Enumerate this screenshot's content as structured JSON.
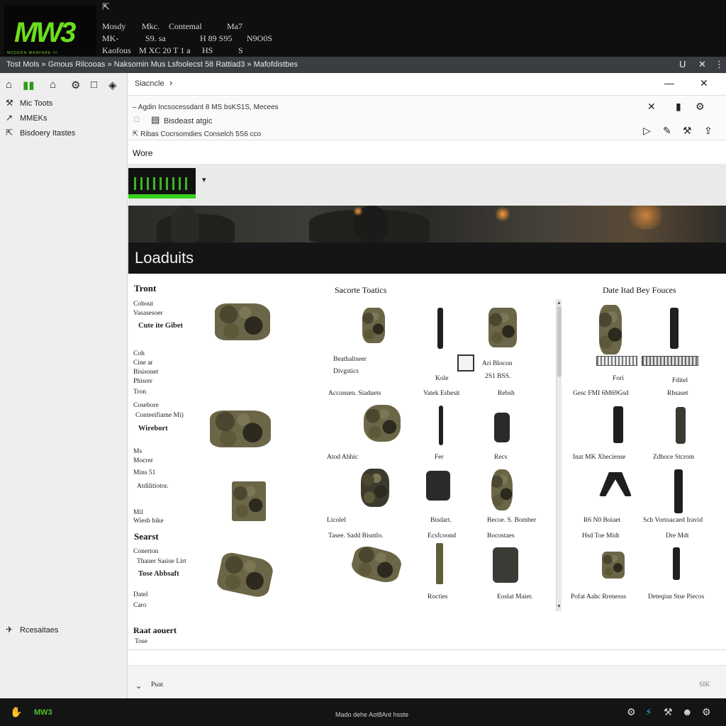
{
  "header": {
    "logo_text": "MW3",
    "logo_sub": "MODERN WARFARE III",
    "row1": [
      "Mosdy",
      "Mkc.",
      "Contemal",
      "Ma7"
    ],
    "row2": [
      "MK-",
      "S9. sa",
      "H 89 S95",
      "N9O0S"
    ],
    "row3": [
      "Kaofous",
      "M XC 20 T 1 a",
      "HS",
      "S"
    ]
  },
  "breadcrumb": {
    "items": [
      "Tost Mols",
      "Gmous Rilcooas",
      "Naksomin Mus",
      "Lsfoolecst 58 Rattiad3",
      "Mafofdistbes"
    ],
    "window_controls": [
      "U",
      "✕",
      "⋮"
    ]
  },
  "sidebar": {
    "items": [
      {
        "label": "Mic Toots",
        "icon": "⚒"
      },
      {
        "label": "MMEKs",
        "icon": "\\u2197"
      },
      {
        "label": "Bisdoery Itastes",
        "icon": "\\u21f1"
      }
    ],
    "bottom_item": {
      "label": "Rcesaitaes",
      "icon": "\\u2708"
    }
  },
  "toolbar": {
    "path_label": "Siacncle",
    "row1": "Agdin Incsocessdant 8 MS bsKS1S, Mecees",
    "row2": "Bisdeast atgic",
    "row3": "Ribas Cocrsomdies Conselch 5S6 cco"
  },
  "section": {
    "wore_label": "Wore",
    "banner_title": "Loaduits"
  },
  "left_column": {
    "heading": "Tront",
    "groups": [
      {
        "lines": [
          "Cobout",
          "Vasasesoer"
        ],
        "bold": "Cute ite Gibet"
      },
      {
        "lines": [
          "Coh",
          "Cine ar",
          "Bisisonet",
          "Phisrer",
          "Tron"
        ],
        "bold": ""
      },
      {
        "lines": [
          "Cosebore",
          "Conteeifiame Mi)"
        ],
        "bold": "Wirebort"
      },
      {
        "lines": [
          "Ms",
          "Mocrer",
          "Mins 51"
        ],
        "bold": "Atdilitiotor."
      },
      {
        "lines": [
          "Mil",
          "Wiesb bike"
        ],
        "bold": ""
      }
    ],
    "heading2": "Searst",
    "group2": {
      "lines": [
        "Conerton",
        "Thaner Sasise Lirt"
      ],
      "bold": "Tose Abbsaft"
    },
    "tail": [
      "Datel",
      "Caro"
    ]
  },
  "middle_column": {
    "heading": "Sacorte Toatics",
    "labels": {
      "r1a": "Beathaltseer",
      "r1b": "Divgstics",
      "r1c": "Kole",
      "r1d": "Ari Blocon",
      "r1e": "2S1 BSS.",
      "r2a": "Acconsen. Siaduets",
      "r2b": "Vatek Esbesit",
      "r2c": "Rebsh",
      "r3a": "Atod Ahhic",
      "r3b": "Fer",
      "r3c": "Recs",
      "r4a": "Licolel",
      "r4b": "Bisdart.",
      "r4c": "Becoe. S. Bomber",
      "r5a": "Tasee. Sadd Bisntlo.",
      "r5b": "Ecsfcoond",
      "r5c": "Bocostaes",
      "r6b": "Rocties",
      "r6c": "Eoslat Maier."
    }
  },
  "right_column": {
    "heading": "Date Itad Bey Fouces",
    "labels": {
      "r1a": "Fori",
      "r1b": "Fditel",
      "r2a": "Gesc FMI 6M69Gsd",
      "r2b": "Rbsaset",
      "r3a": "Inat MK Xheciense",
      "r3b": "Zdhoce Stcrom",
      "r4a": "R6 N0 Boiaet",
      "r4b": "Sch Vortoacaed Iravid",
      "r5a": "Hsd Toe Midt",
      "r5b": "Dre Mdt",
      "r6a": "Pofat Aahc Rrenesss",
      "r6b": "Deteqisn Stse Piecos"
    }
  },
  "footer": {
    "heading": "Raat aouert",
    "sub": "Tose",
    "expand_label": "Puat",
    "right_label": "SIK"
  },
  "taskbar": {
    "center_text": "Mado dehe Aot8Ant hsste"
  },
  "colors": {
    "accent_green": "#38d11f",
    "header_bg": "#0f0f10",
    "crumb_bg": "#3a3d42"
  }
}
